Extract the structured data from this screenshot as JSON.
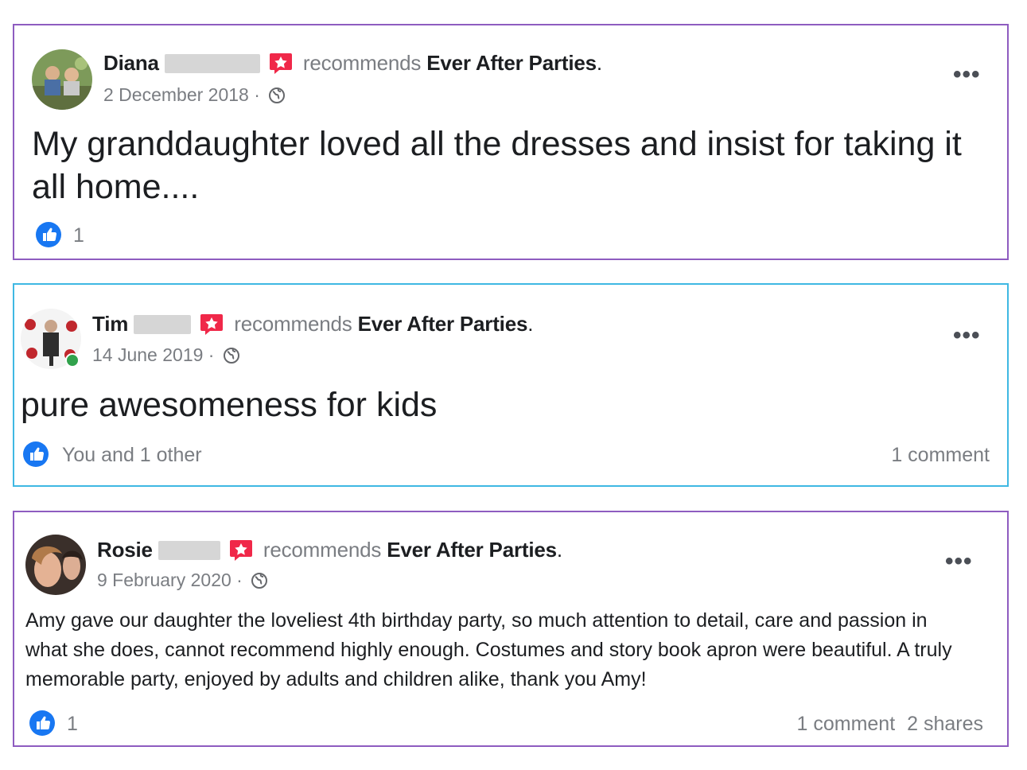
{
  "colors": {
    "card1_border": "#8e5cc0",
    "card2_border": "#3fb8e3",
    "card3_border": "#8e5cc0",
    "like_blue": "#1877f2",
    "recommend_red": "#f02849",
    "muted_text": "#7a7d82"
  },
  "posts": [
    {
      "author_first": "Diana",
      "recommends": "recommends",
      "page": "Ever After Parties",
      "dot": ".",
      "date": "2 December 2018 ·",
      "text": "My granddaughter loved all the dresses and insist for taking it all home....",
      "reactions": "1",
      "comments": "",
      "shares": "",
      "icons": [
        "avatar-photo",
        "recommend-badge-icon",
        "globe-icon",
        "more-options-icon",
        "like-icon"
      ]
    },
    {
      "author_first": "Tim",
      "recommends": "recommends",
      "page": "Ever After Parties",
      "dot": ".",
      "date": "14 June 2019 ·",
      "text": "pure awesomeness for kids",
      "reactions": "You and 1 other",
      "comments": "1 comment",
      "shares": "",
      "icons": [
        "avatar-photo",
        "online-indicator",
        "recommend-badge-icon",
        "globe-icon",
        "more-options-icon",
        "like-icon"
      ]
    },
    {
      "author_first": "Rosie",
      "recommends": "recommends",
      "page": "Ever After Parties",
      "dot": ".",
      "date": "9 February 2020 ·",
      "text": "Amy gave our daughter the loveliest 4th birthday party, so much attention to detail, care and passion in what she does, cannot recommend highly enough. Costumes and story book apron were beautiful. A truly memorable party, enjoyed by adults and children alike, thank you Amy!",
      "reactions": "1",
      "comments": "1 comment",
      "shares": "2 shares",
      "icons": [
        "avatar-photo",
        "recommend-badge-icon",
        "globe-icon",
        "more-options-icon",
        "like-icon"
      ]
    }
  ]
}
